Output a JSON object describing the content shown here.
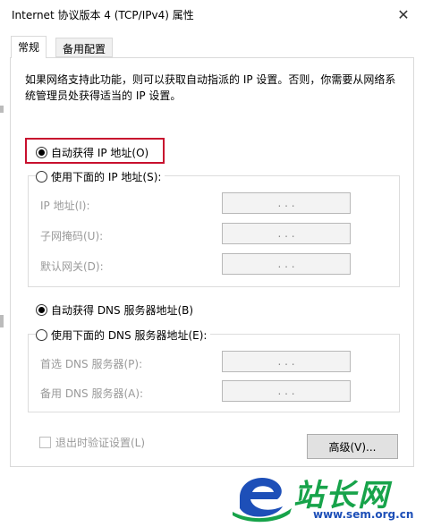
{
  "window": {
    "title": "Internet 协议版本 4 (TCP/IPv4) 属性",
    "close_glyph": "✕"
  },
  "tabs": [
    {
      "label": "常规",
      "active": true
    },
    {
      "label": "备用配置",
      "active": false
    }
  ],
  "description": "如果网络支持此功能，则可以获取自动指派的 IP 设置。否则，你需要从网络系统管理员处获得适当的 IP 设置。",
  "ip_section": {
    "auto_label": "自动获得 IP 地址(O)",
    "auto_checked": true,
    "manual_label": "使用下面的 IP 地址(S):",
    "manual_checked": false,
    "fields": [
      {
        "label": "IP 地址(I):",
        "value": ". . ."
      },
      {
        "label": "子网掩码(U):",
        "value": ". . ."
      },
      {
        "label": "默认网关(D):",
        "value": ". . ."
      }
    ]
  },
  "dns_section": {
    "auto_label": "自动获得 DNS 服务器地址(B)",
    "auto_checked": true,
    "manual_label": "使用下面的 DNS 服务器地址(E):",
    "manual_checked": false,
    "fields": [
      {
        "label": "首选 DNS 服务器(P):",
        "value": ". . ."
      },
      {
        "label": "备用 DNS 服务器(A):",
        "value": ". . ."
      }
    ]
  },
  "validate_label": "退出时验证设置(L)",
  "advanced_label": "高级(V)...",
  "watermark": {
    "brand": "站长网",
    "url": "www.sem.org.cn"
  },
  "colors": {
    "highlight": "#c8102e",
    "disabled_text": "#9a9a9a",
    "watermark_green": "#17a34a",
    "watermark_blue": "#1d4fb8"
  }
}
